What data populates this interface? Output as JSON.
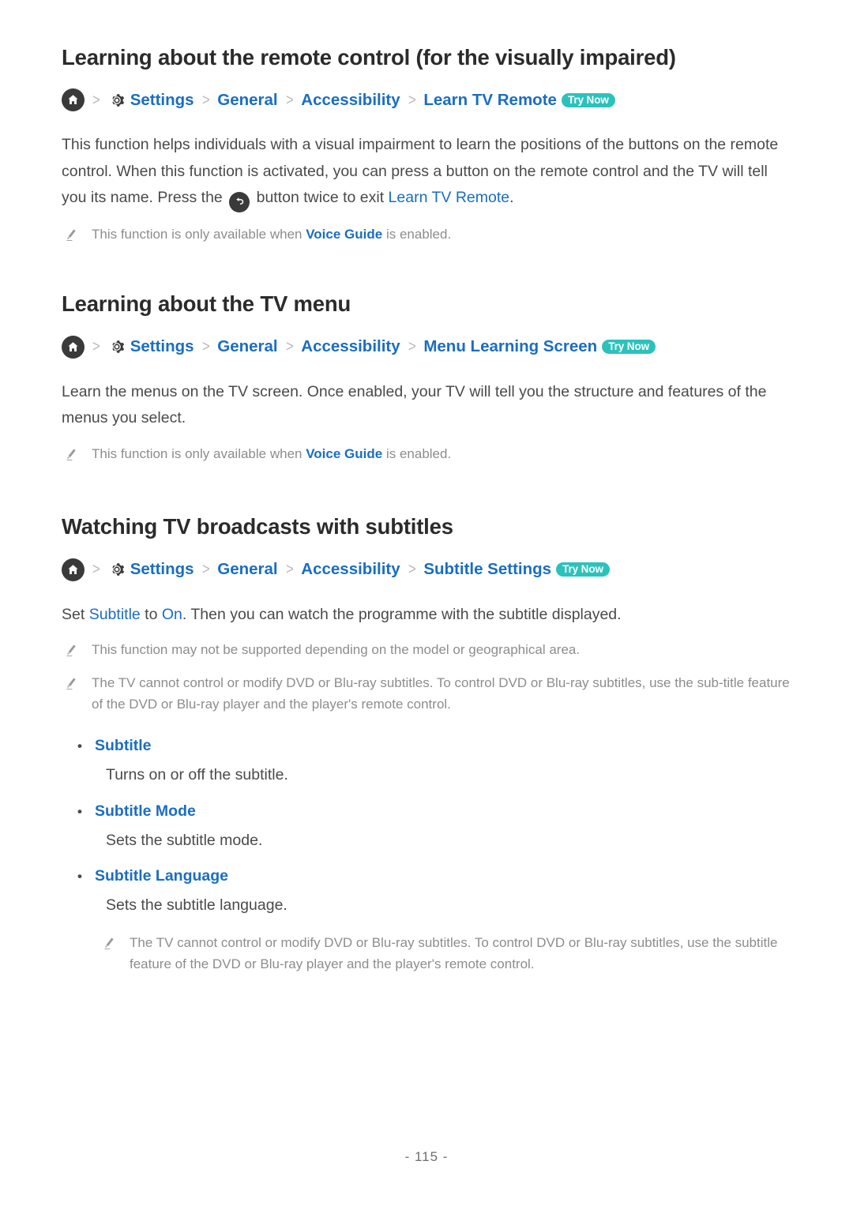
{
  "page": {
    "number_label": "- 115 -"
  },
  "icons": {
    "home": "home-icon",
    "gear": "gear-icon",
    "back": "return-arrow-icon",
    "note": "pencil-icon",
    "separator": ">"
  },
  "colors": {
    "link_blue": "#1a6ec0",
    "badge_teal": "#2cc2bc",
    "heading": "#2b2b2b",
    "body": "#4a4a4a",
    "note_gray": "#8d8d8d"
  },
  "sections": [
    {
      "title": "Learning about the remote control (for the visually impaired)",
      "breadcrumb": {
        "items": [
          "Settings",
          "General",
          "Accessibility",
          "Learn TV Remote"
        ],
        "badge": "Try Now"
      },
      "paragraph": {
        "part1": "This function helps individuals with a visual impairment to learn the positions of the buttons on the remote control. When this function is activated, you can press a button on the remote control and the TV will tell you its name. Press the",
        "part2": "button twice to exit",
        "link": "Learn TV Remote",
        "part3": "."
      },
      "notes": [
        {
          "before": "This function is only available when",
          "link": "Voice Guide",
          "after": "is enabled."
        }
      ]
    },
    {
      "title": "Learning about the TV menu",
      "breadcrumb": {
        "items": [
          "Settings",
          "General",
          "Accessibility",
          "Menu Learning Screen"
        ],
        "badge": "Try Now"
      },
      "paragraph": {
        "text": "Learn the menus on the TV screen. Once enabled, your TV will tell you the structure and features of the menus you select."
      },
      "notes": [
        {
          "before": "This function is only available when",
          "link": "Voice Guide",
          "after": "is enabled."
        }
      ]
    },
    {
      "title": "Watching TV broadcasts with subtitles",
      "breadcrumb": {
        "items": [
          "Settings",
          "General",
          "Accessibility",
          "Subtitle Settings"
        ],
        "badge": "Try Now"
      },
      "paragraph": {
        "part1": "Set",
        "link1": "Subtitle",
        "part2": "to",
        "link2": "On",
        "part3": ". Then you can watch the programme with the subtitle displayed."
      },
      "notes": [
        {
          "text": "This function may not be supported depending on the model or geographical area."
        },
        {
          "text": "The TV cannot control or modify DVD or Blu-ray subtitles. To control DVD or Blu-ray subtitles, use the sub-title feature of the DVD or Blu-ray player and the player's remote control."
        }
      ],
      "bullets": [
        {
          "label": "Subtitle",
          "desc": "Turns on or off the subtitle."
        },
        {
          "label": "Subtitle Mode",
          "desc": "Sets the subtitle mode."
        },
        {
          "label": "Subtitle Language",
          "desc": "Sets the subtitle language."
        }
      ],
      "trailing_note": {
        "text": "The TV cannot control or modify DVD or Blu-ray subtitles. To control DVD or Blu-ray subtitles, use the subtitle feature of the DVD or Blu-ray player and the player's remote control."
      }
    }
  ]
}
